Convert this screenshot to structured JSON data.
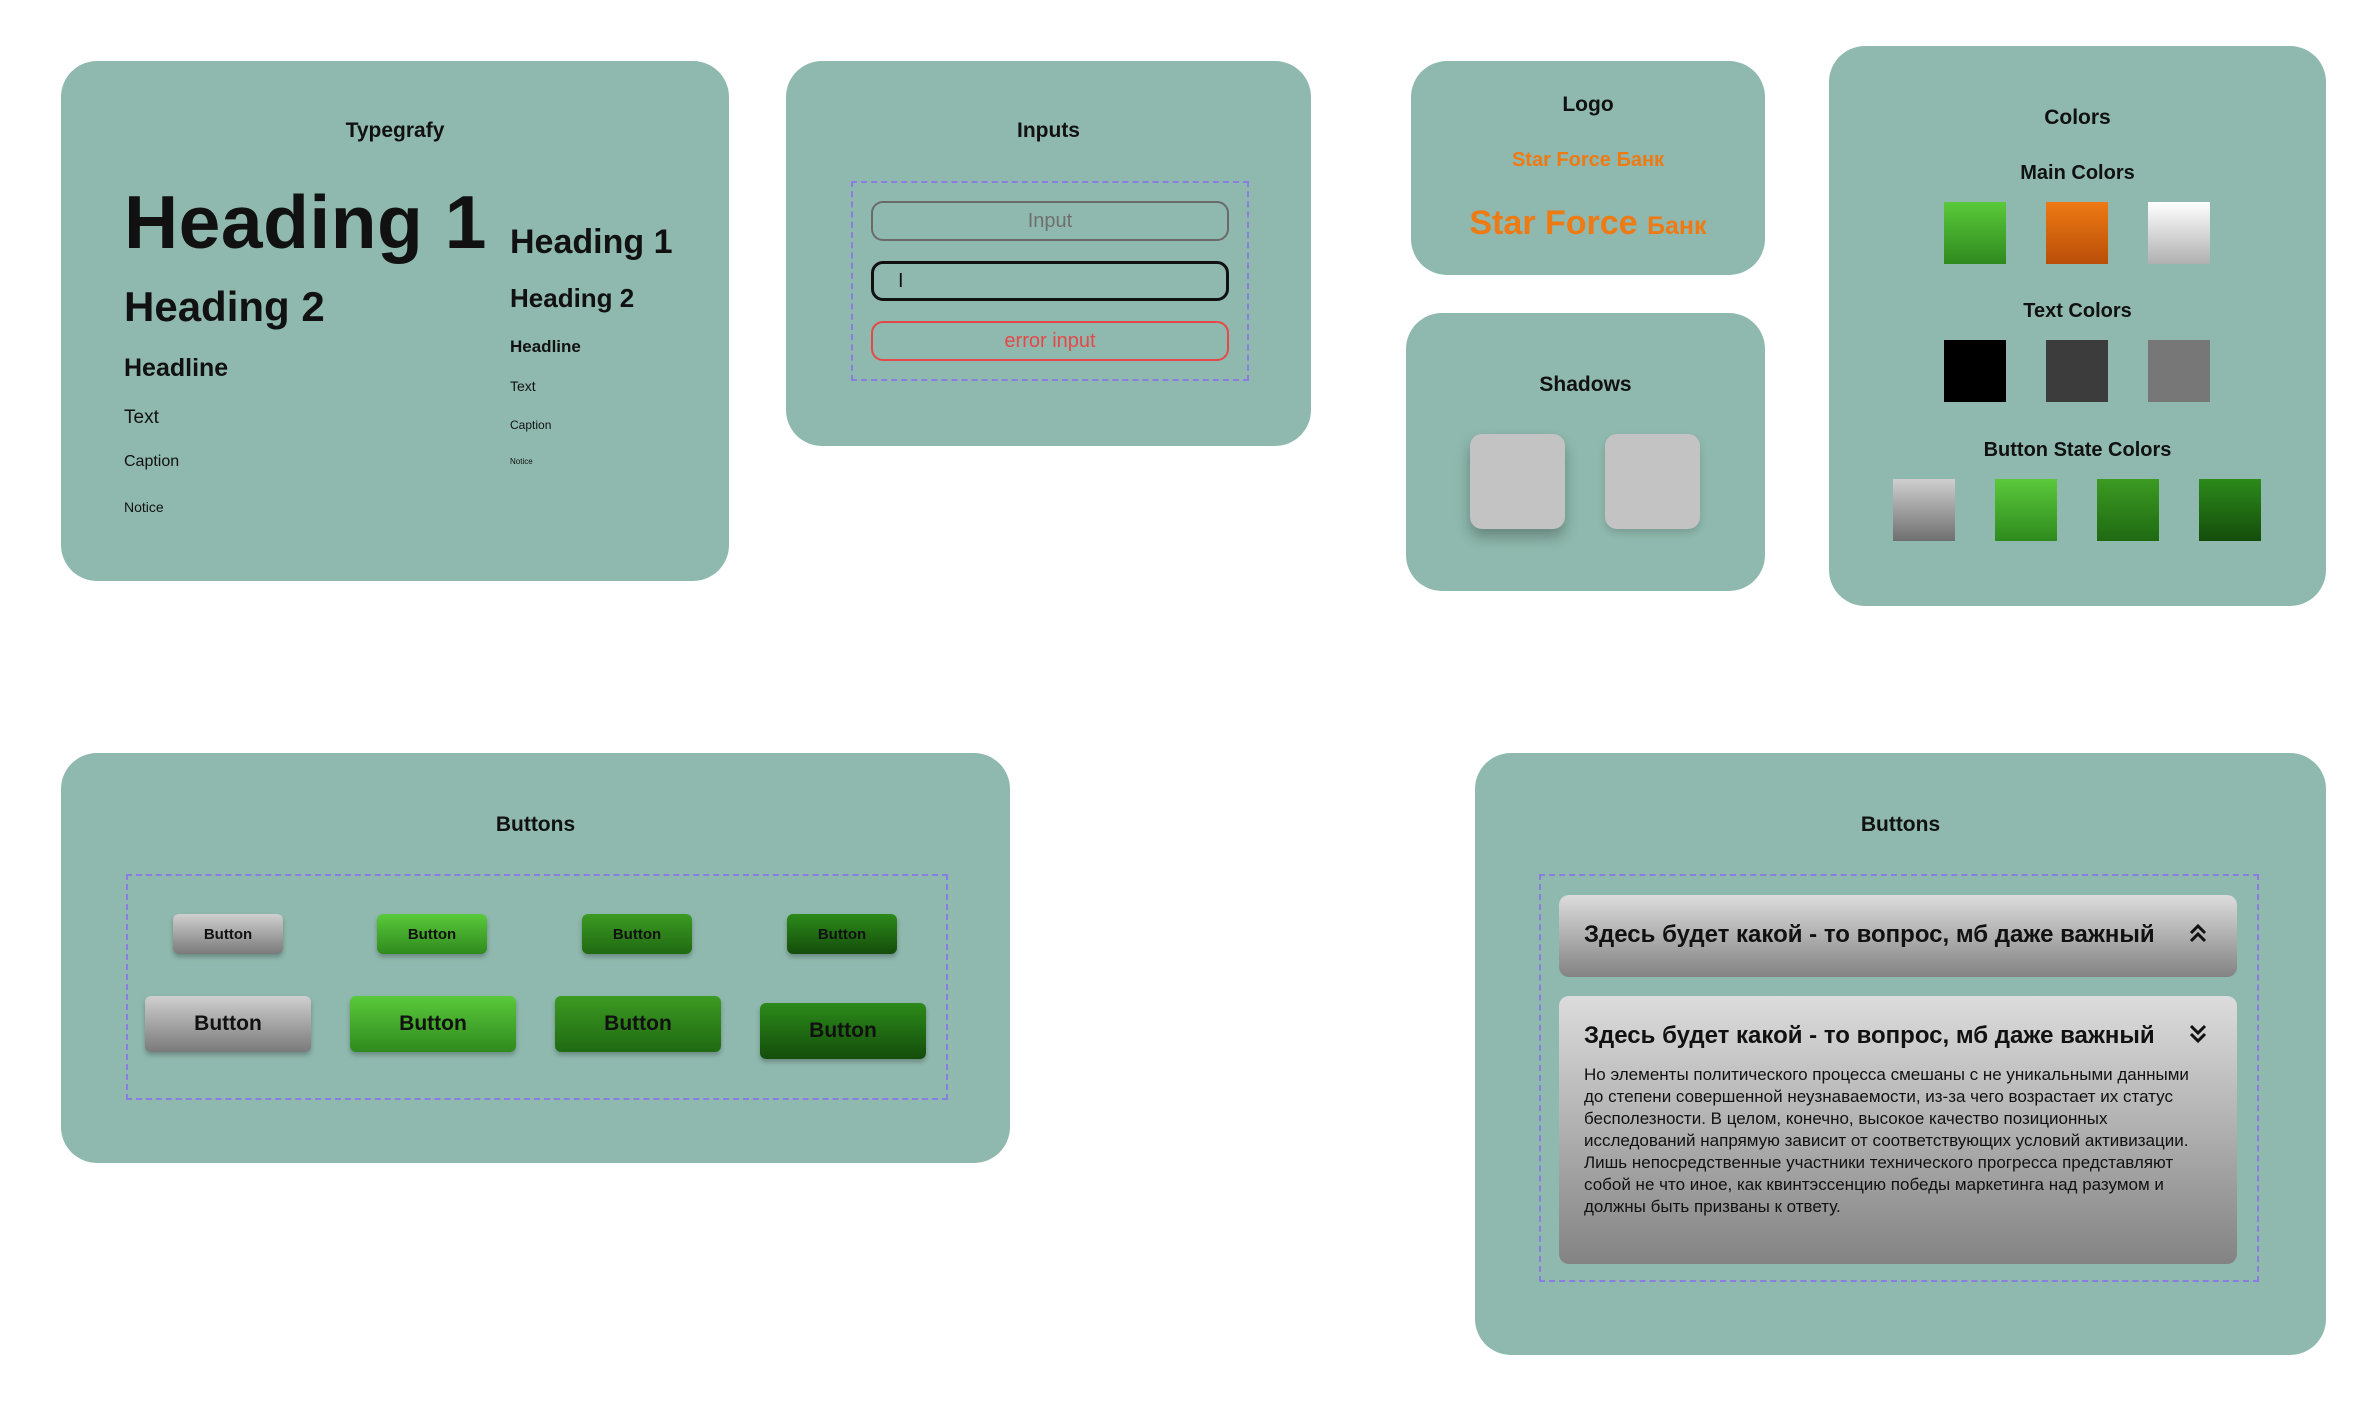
{
  "typography": {
    "title": "Typegrafy",
    "large": {
      "h1": "Heading 1",
      "h2": "Heading 2",
      "headline": "Headline",
      "text": "Text",
      "caption": "Caption",
      "notice": "Notice"
    },
    "small": {
      "h1": "Heading 1",
      "h2": "Heading 2",
      "headline": "Headline",
      "text": "Text",
      "caption": "Caption",
      "notice": "Notice"
    }
  },
  "inputs": {
    "title": "Inputs",
    "default_placeholder": "Input",
    "focused_value": "I",
    "error_value": "error input",
    "colors": {
      "border": "#6a6a6a",
      "focus": "#111111",
      "error": "#e54848"
    }
  },
  "logo": {
    "title": "Logo",
    "small": {
      "brand": "Star Force",
      "suffix": "Банк"
    },
    "large": {
      "brand": "Star Force",
      "suffix": "Банк"
    },
    "color": "#ee7a14"
  },
  "shadows": {
    "title": "Shadows"
  },
  "colors": {
    "title": "Colors",
    "main_label": "Main Colors",
    "main": [
      "#3fa82a",
      "#e56a0e",
      "#d8d8d8"
    ],
    "text_label": "Text Colors",
    "text": [
      "#000000",
      "#3c3c3c",
      "#777777"
    ],
    "state_label": "Button State Colors",
    "state": [
      "#8d8d8d",
      "#46b82e",
      "#2f8a1e",
      "#1c6212"
    ]
  },
  "buttons_panel": {
    "title": "Buttons",
    "small": [
      "Button",
      "Button",
      "Button",
      "Button"
    ],
    "large": [
      "Button",
      "Button",
      "Button",
      "Button"
    ]
  },
  "accordion_panel": {
    "title": "Buttons",
    "items": [
      {
        "question": "Здесь будет какой - то вопрос, мб даже важный",
        "icon": "chevron-double-up-icon"
      },
      {
        "question": "Здесь будет какой - то вопрос, мб даже важный",
        "icon": "chevron-double-down-icon",
        "answer": "Но элементы политического процесса смешаны с не уникальными данными до степени совершенной неузнаваемости, из-за чего возрастает их статус бесполезности. В целом, конечно, высокое качество позиционных исследований напрямую зависит от соответствующих условий активизации. Лишь непосредственные участники технического прогресса представляют собой не что иное, как квинтэссенцию победы маркетинга над разумом и должны быть призваны к ответу."
      }
    ]
  }
}
